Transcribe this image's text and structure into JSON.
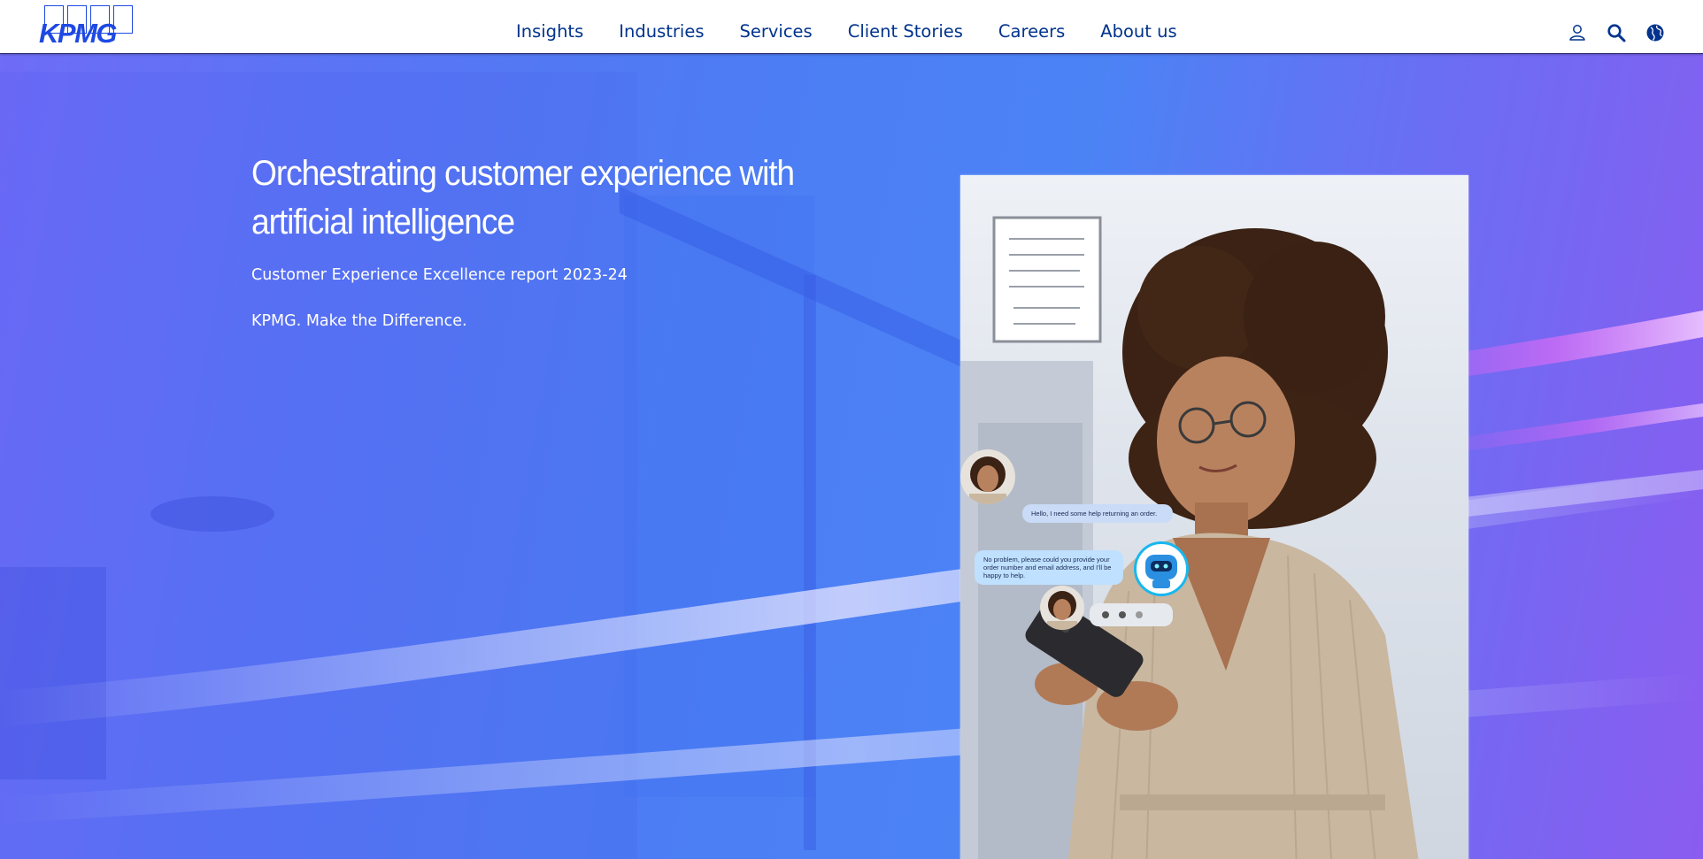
{
  "header": {
    "logo": {
      "text": "KPMG",
      "icon": "kpmg-logo"
    },
    "nav": [
      {
        "label": "Insights"
      },
      {
        "label": "Industries"
      },
      {
        "label": "Services"
      },
      {
        "label": "Client Stories"
      },
      {
        "label": "Careers"
      },
      {
        "label": "About us"
      }
    ],
    "utility_icons": [
      "user-icon",
      "search-icon",
      "globe-icon"
    ],
    "accent_color": "#00338d",
    "logo_color": "#1e49e2"
  },
  "hero": {
    "title": "Orchestrating customer experience with artificial intelligence",
    "subtitle": "Customer Experience Excellence report 2023-24",
    "tagline": "KPMG. Make the Difference.",
    "chat": {
      "user_message": "Hello, I need some help returning an order.",
      "bot_message": "No problem, please could you provide your order number and email address, and I'll be happy to help."
    },
    "background_color": "#4d7cf4"
  }
}
